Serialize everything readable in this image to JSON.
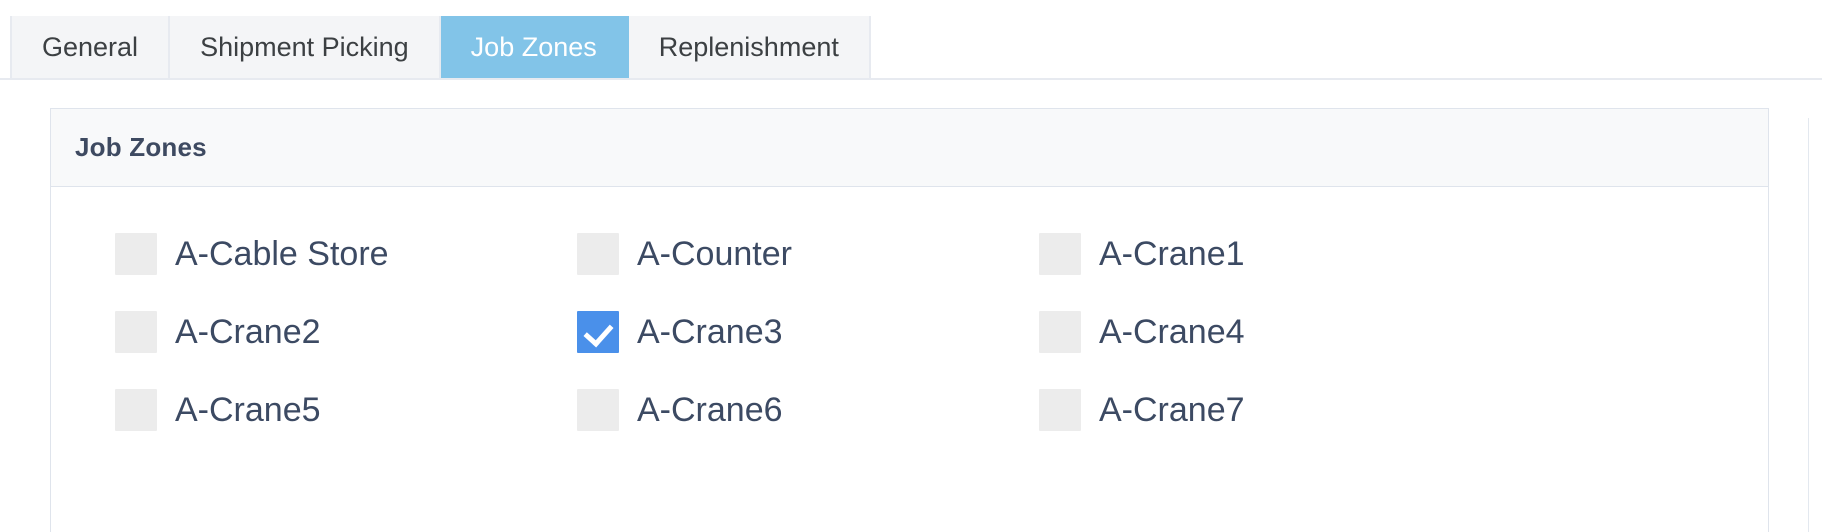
{
  "tabs": [
    {
      "label": "General",
      "active": false
    },
    {
      "label": "Shipment Picking",
      "active": false
    },
    {
      "label": "Job Zones",
      "active": true
    },
    {
      "label": "Replenishment",
      "active": false
    }
  ],
  "panel": {
    "title": "Job Zones"
  },
  "zones": [
    {
      "label": "A-Cable Store",
      "checked": false
    },
    {
      "label": "A-Counter",
      "checked": false
    },
    {
      "label": "A-Crane1",
      "checked": false
    },
    {
      "label": "A-Crane2",
      "checked": false
    },
    {
      "label": "A-Crane3",
      "checked": true
    },
    {
      "label": "A-Crane4",
      "checked": false
    },
    {
      "label": "A-Crane5",
      "checked": false
    },
    {
      "label": "A-Crane6",
      "checked": false
    },
    {
      "label": "A-Crane7",
      "checked": false
    }
  ],
  "colors": {
    "active_tab_background": "#82c4e8",
    "checked_checkbox": "#4a90ea",
    "unchecked_checkbox": "#ececec",
    "label_text": "#3c4a63",
    "panel_header_background": "#f8f9fa",
    "panel_border": "#dfe4ec"
  }
}
